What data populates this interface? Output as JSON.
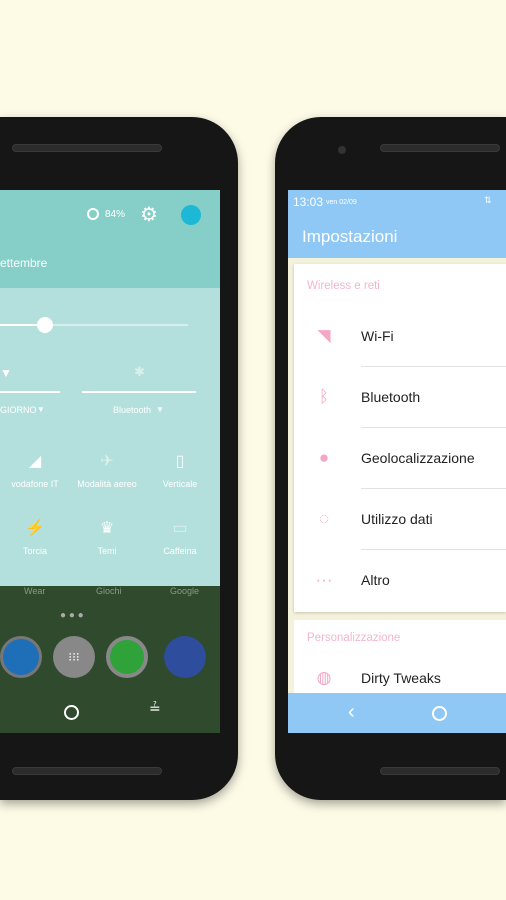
{
  "left_phone": {
    "battery": "84%",
    "date_partial": "ettembre",
    "wifi_label": "GIORNO",
    "bluetooth_label": "Bluetooth",
    "tiles": [
      {
        "label": "vodafone IT",
        "icon": "signal-icon"
      },
      {
        "label": "Modalità aereo",
        "icon": "airplane-icon"
      },
      {
        "label": "Verticale",
        "icon": "phone-portrait-icon"
      },
      {
        "label": "Torcia",
        "icon": "flashlight-icon"
      },
      {
        "label": "Temi",
        "icon": "themes-icon"
      },
      {
        "label": "Caffeina",
        "icon": "coffee-icon"
      }
    ],
    "home_labels": [
      "Wear",
      "Giochi",
      "Google"
    ],
    "brightness": 0.24,
    "colors": {
      "header": "#86cfc8",
      "panel": "#b3e0dc"
    }
  },
  "right_phone": {
    "status_time": "13:03",
    "status_date": "ven 02/09",
    "title": "Impostazioni",
    "sections": [
      {
        "header": "Wireless e reti",
        "items": [
          {
            "label": "Wi-Fi",
            "icon": "wifi-icon"
          },
          {
            "label": "Bluetooth",
            "icon": "bluetooth-icon"
          },
          {
            "label": "Geolocalizzazione",
            "icon": "location-icon"
          },
          {
            "label": "Utilizzo dati",
            "icon": "data-usage-icon"
          },
          {
            "label": "Altro",
            "icon": "more-icon"
          }
        ]
      },
      {
        "header": "Personalizzazione",
        "items": [
          {
            "label": "Dirty Tweaks",
            "icon": "tweaks-icon"
          }
        ]
      }
    ],
    "colors": {
      "toolbar": "#90c8f5",
      "accent": "#f4a6c4"
    }
  }
}
